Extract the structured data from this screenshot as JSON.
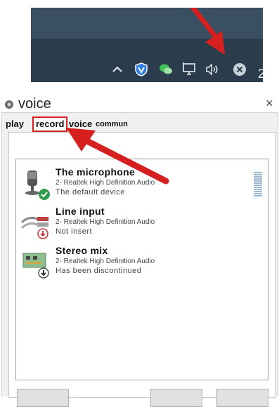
{
  "taskbar": {
    "icons": [
      "chevron-up-icon",
      "shield-icon",
      "wechat-icon",
      "network-icon",
      "speaker-icon",
      "close-circle-icon"
    ],
    "clock_fragment": "2"
  },
  "window": {
    "title": "voice",
    "close_glyph": "×"
  },
  "tabs": [
    {
      "label": "play",
      "selected": false
    },
    {
      "label": "record",
      "selected": true
    },
    {
      "label": "voice",
      "selected": false
    },
    {
      "label": "commun",
      "selected": false
    }
  ],
  "devices": [
    {
      "name": "The microphone",
      "driver": "2- Realtek High Definition Audio",
      "status": "The default device",
      "icon": "microphone-icon",
      "badge": "default-check-badge"
    },
    {
      "name": "Line input",
      "driver": "2- Realtek High Definition Audio",
      "status": "Not insert",
      "icon": "line-input-cable-icon",
      "badge": "unplugged-badge"
    },
    {
      "name": "Stereo mix",
      "driver": "2- Realtek High Definition Audio",
      "status": "Has been discontinued",
      "icon": "sound-card-icon",
      "badge": "disabled-badge"
    }
  ],
  "colors": {
    "taskbar": "#2b3d4d",
    "highlight": "#d32f2f",
    "default_badge": "#2e9c4a"
  }
}
